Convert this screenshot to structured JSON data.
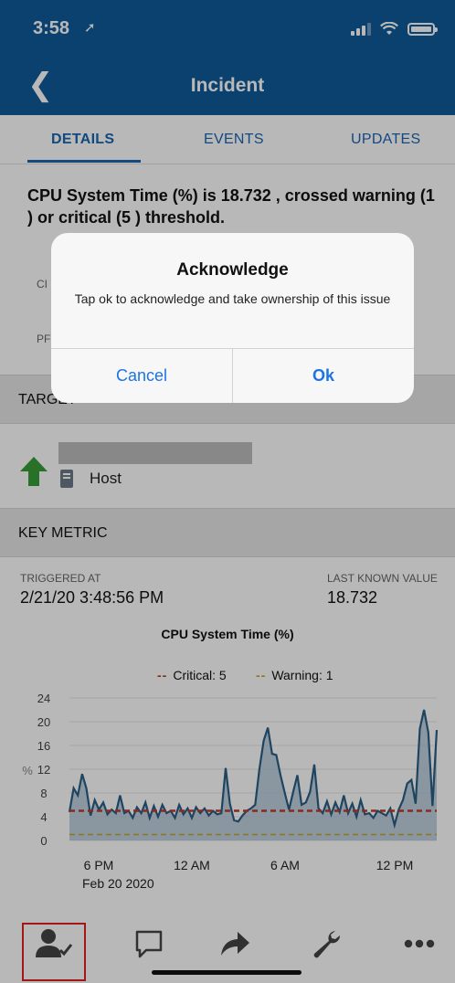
{
  "status_bar": {
    "time": "3:58"
  },
  "nav": {
    "title": "Incident"
  },
  "tabs": [
    {
      "label": "DETAILS"
    },
    {
      "label": "EVENTS"
    },
    {
      "label": "UPDATES"
    }
  ],
  "incident": {
    "message": "CPU System Time (%) is 18.732 , crossed warning (1 ) or critical (5 ) threshold."
  },
  "partial_rows": {
    "row1": "CI",
    "row2": "PF"
  },
  "sections": {
    "target": "TARGET",
    "key_metric": "KEY METRIC"
  },
  "target": {
    "type": "Host",
    "status_icon": "arrow-up-icon"
  },
  "metric": {
    "triggered_label": "TRIGGERED AT",
    "triggered_value": "2/21/20 3:48:56 PM",
    "last_label": "LAST KNOWN VALUE",
    "last_value": "18.732"
  },
  "chart_data": {
    "type": "area",
    "title": "CPU System Time (%)",
    "ylabel": "%",
    "ylim": [
      0,
      24
    ],
    "yticks": [
      0,
      4,
      8,
      12,
      16,
      20,
      24
    ],
    "x_tick_labels": [
      "6 PM",
      "12 AM",
      "6 AM",
      "12 PM"
    ],
    "x_sublabel": "Feb 20 2020",
    "series": [
      {
        "name": "CPU System Time (%)",
        "values": [
          4.8,
          8.8,
          7.6,
          11.2,
          8.8,
          4.2,
          6.8,
          5.2,
          6.4,
          4.4,
          5.2,
          4.6,
          7.6,
          4.6,
          5.0,
          3.8,
          5.6,
          4.6,
          6.4,
          3.8,
          5.8,
          4.0,
          6.0,
          4.6,
          5.0,
          3.8,
          6.0,
          4.4,
          5.4,
          3.8,
          5.6,
          4.6,
          5.4,
          4.2,
          5.0,
          4.4,
          4.6,
          12.2,
          6.2,
          3.4,
          3.2,
          4.2,
          5.0,
          5.4,
          6.0,
          12.0,
          16.8,
          19.0,
          14.6,
          14.4,
          11.0,
          8.0,
          5.2,
          8.2,
          11.0,
          6.0,
          6.4,
          8.2,
          12.8,
          5.4,
          4.6,
          6.6,
          4.4,
          6.4,
          4.8,
          7.6,
          4.6,
          6.2,
          4.0,
          6.8,
          4.4,
          4.6,
          3.8,
          5.0,
          4.6,
          4.2,
          5.4,
          2.6,
          5.2,
          6.8,
          9.6,
          10.2,
          6.2,
          18.8,
          22.0,
          18.2,
          5.8,
          18.6
        ]
      }
    ],
    "thresholds": [
      {
        "name": "Critical",
        "value": 5,
        "color": "#c0392b"
      },
      {
        "name": "Warning",
        "value": 1,
        "color": "#c9a227"
      }
    ],
    "legend": {
      "critical": "Critical: 5",
      "warning": "Warning: 1",
      "position": "top"
    }
  },
  "dialog": {
    "title": "Acknowledge",
    "message": "Tap ok to acknowledge and take ownership of this issue",
    "cancel": "Cancel",
    "ok": "Ok"
  },
  "tabbar": [
    {
      "icon": "acknowledge-user-icon"
    },
    {
      "icon": "comment-icon"
    },
    {
      "icon": "forward-icon"
    },
    {
      "icon": "wrench-icon"
    },
    {
      "icon": "more-icon"
    }
  ],
  "colors": {
    "nav_bg": "#0f5a9a",
    "accent": "#1a66b3",
    "series_line": "#2a5f86",
    "series_fill": "#a9c2d6"
  }
}
